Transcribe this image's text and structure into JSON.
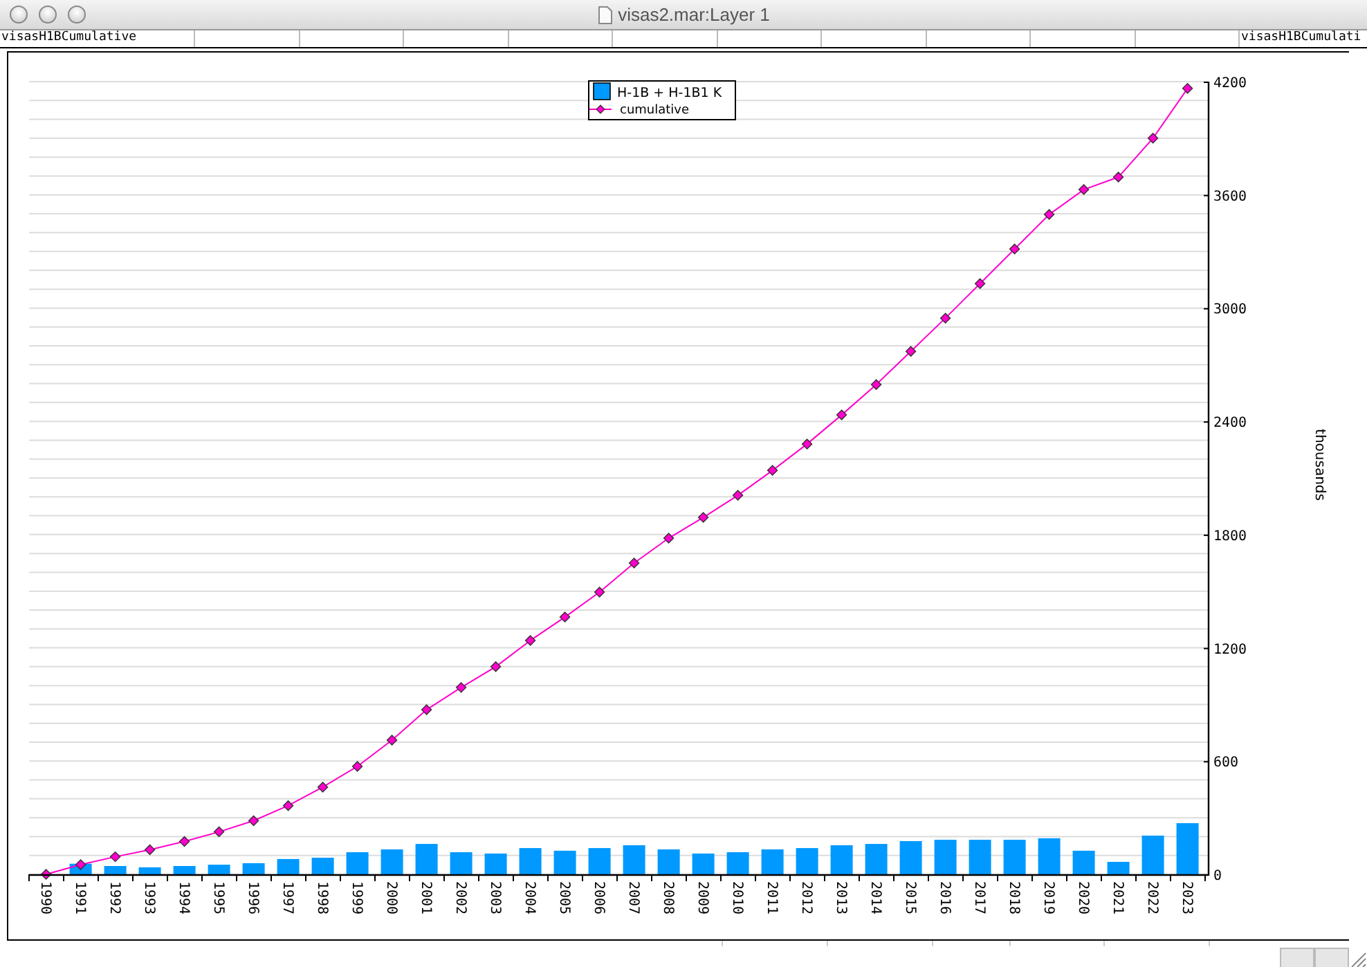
{
  "window": {
    "title": "visas2.mar:Layer 1"
  },
  "header": {
    "left_label": "visasH1BCumulative",
    "right_label": "visasH1BCumulati"
  },
  "chart": {
    "chart_data": {
      "type": "bar",
      "ylabel": "thousands",
      "categories": [
        "1990",
        "1991",
        "1992",
        "1993",
        "1994",
        "1995",
        "1996",
        "1997",
        "1998",
        "1999",
        "2000",
        "2001",
        "2002",
        "2003",
        "2004",
        "2005",
        "2006",
        "2007",
        "2008",
        "2009",
        "2010",
        "2011",
        "2012",
        "2013",
        "2014",
        "2015",
        "2016",
        "2017",
        "2018",
        "2019",
        "2020",
        "2021",
        "2022",
        "2023"
      ],
      "ylim": [
        0,
        4200
      ],
      "yticks": [
        0,
        600,
        1200,
        1800,
        2400,
        3000,
        3600,
        4200
      ],
      "grid": true,
      "legend": "top",
      "series": [
        {
          "name": "H-1B + H-1B1 K",
          "color": "#0099ff",
          "values": [
            null,
            56,
            44,
            37,
            44,
            51,
            59,
            81,
            88,
            117,
            132,
            161,
            117,
            110,
            139,
            125,
            139,
            154,
            132,
            110,
            117,
            132,
            139,
            154,
            161,
            176,
            183,
            183,
            183,
            191,
            125,
            66,
            205,
            271
          ]
        },
        {
          "name": "cumulative",
          "color": "#ff00cc",
          "type": "line",
          "marker": "diamond",
          "values": [
            0,
            51,
            93,
            130,
            174,
            225,
            284,
            364,
            462,
            572,
            711,
            872,
            990,
            1100,
            1239,
            1363,
            1495,
            1649,
            1781,
            1891,
            2008,
            2140,
            2280,
            2434,
            2595,
            2771,
            2947,
            3130,
            3313,
            3496,
            3628,
            3694,
            3900,
            4164
          ]
        }
      ]
    }
  }
}
